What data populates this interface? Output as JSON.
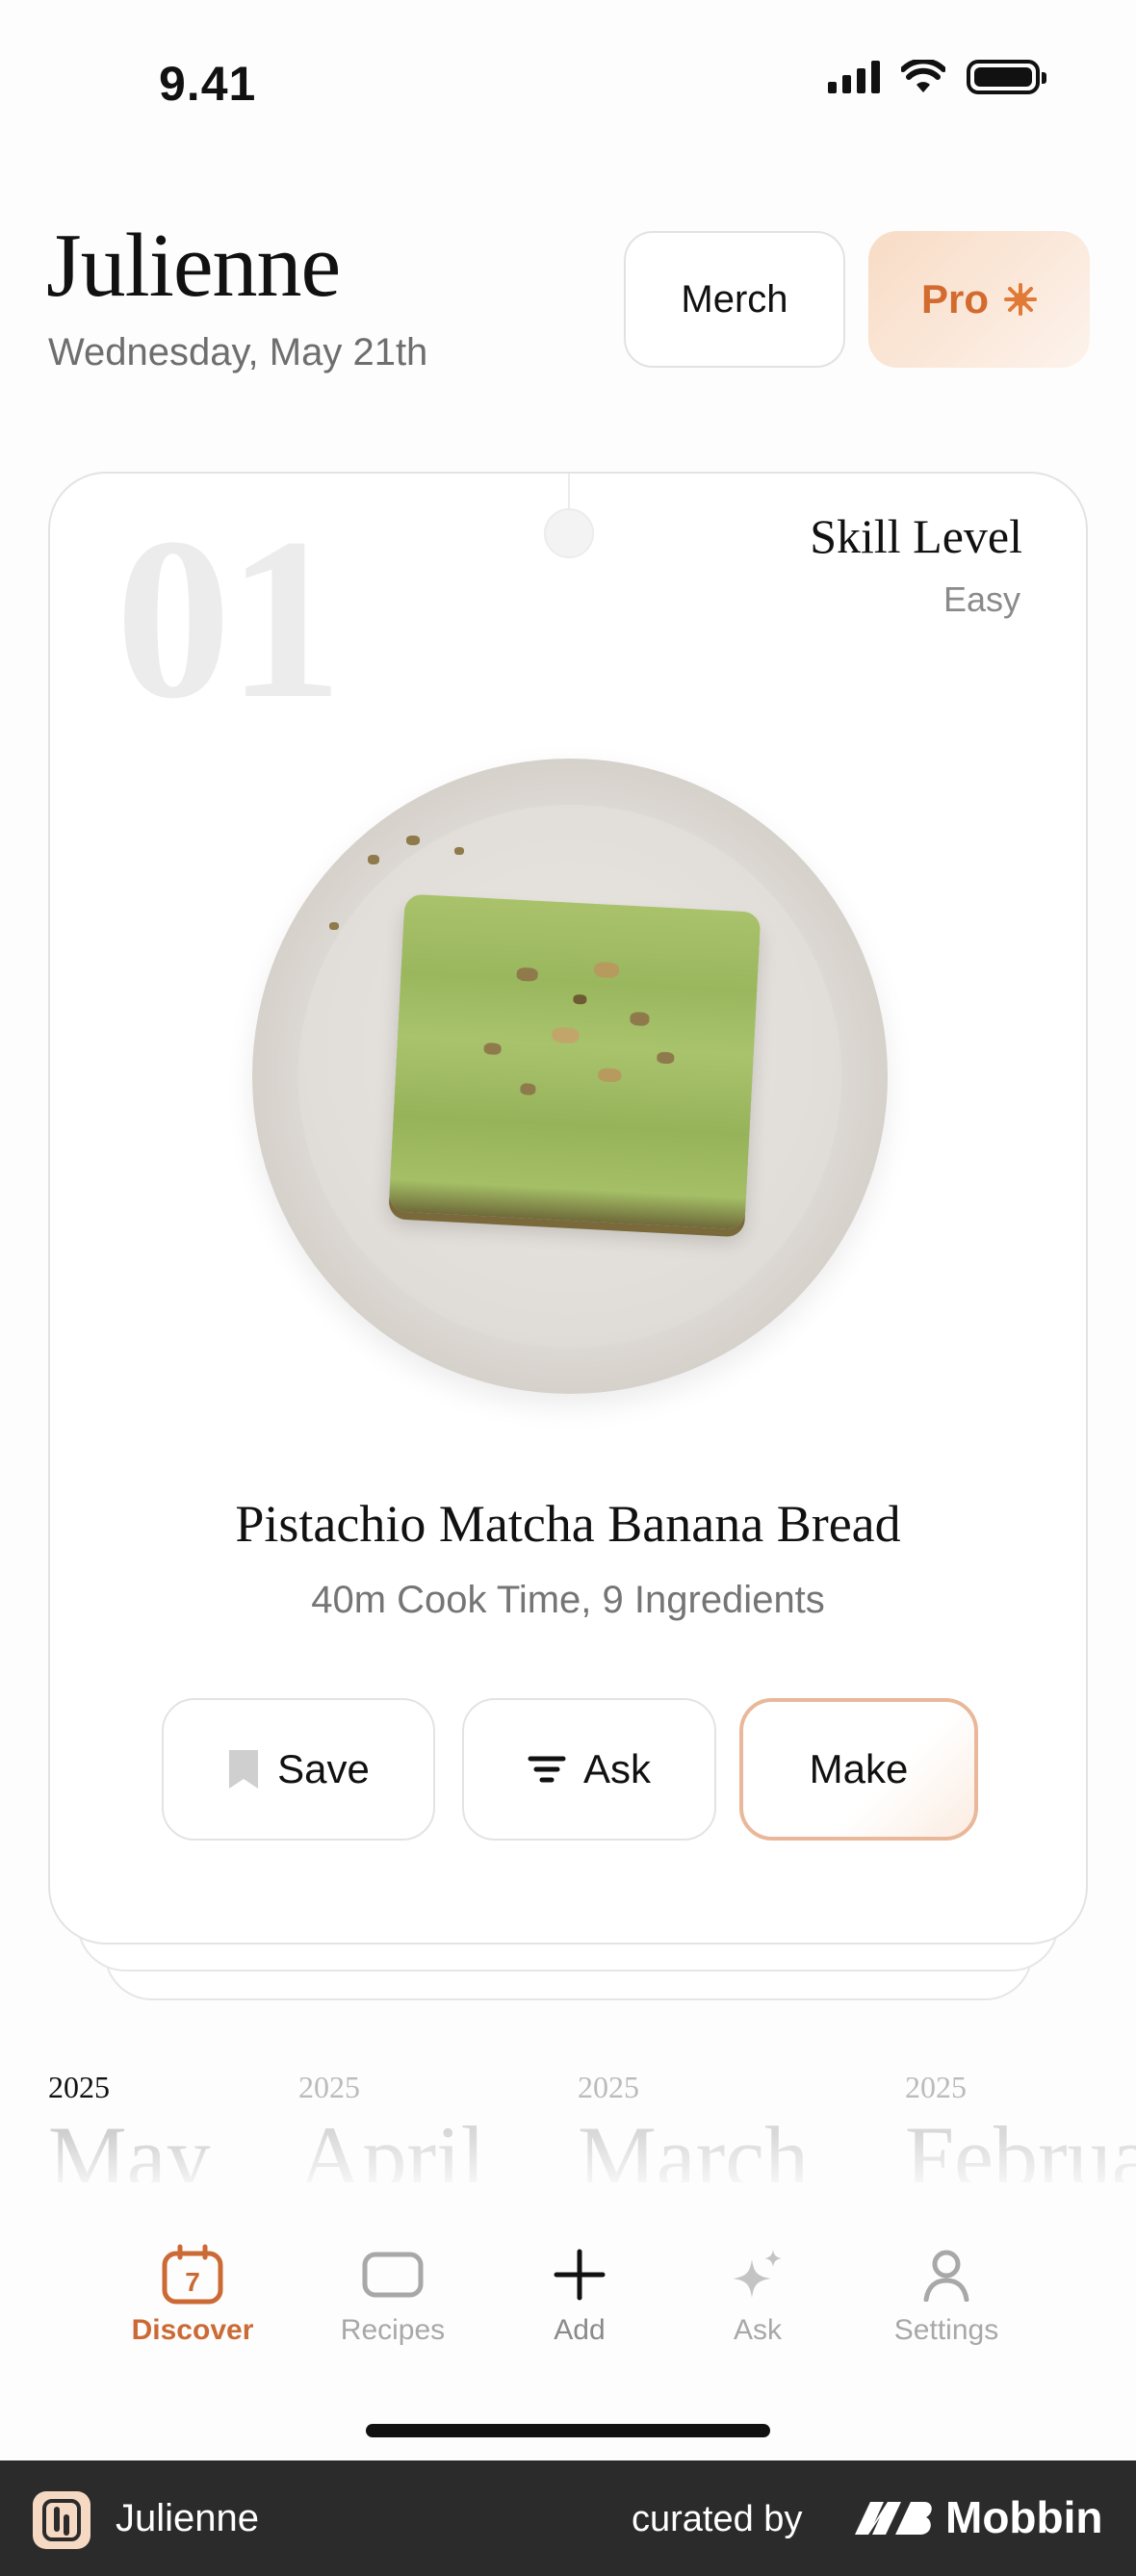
{
  "status_bar": {
    "time": "9.41"
  },
  "header": {
    "app_title": "Julienne",
    "date": "Wednesday, May 21th",
    "merch_label": "Merch",
    "pro_label": "Pro"
  },
  "card": {
    "number": "01",
    "skill_label": "Skill Level",
    "skill_value": "Easy",
    "recipe_title": "Pistachio Matcha Banana Bread",
    "recipe_meta": "40m Cook Time, 9 Ingredients",
    "save_label": "Save",
    "ask_label": "Ask",
    "make_label": "Make"
  },
  "months": [
    {
      "year": "2025",
      "month": "May"
    },
    {
      "year": "2025",
      "month": "April"
    },
    {
      "year": "2025",
      "month": "March"
    },
    {
      "year": "2025",
      "month": "February"
    }
  ],
  "tabs": [
    {
      "label": "Discover",
      "icon": "calendar-icon",
      "badge": "7"
    },
    {
      "label": "Recipes",
      "icon": "card-icon"
    },
    {
      "label": "Add",
      "icon": "plus-icon"
    },
    {
      "label": "Ask",
      "icon": "sparkle-icon"
    },
    {
      "label": "Settings",
      "icon": "person-icon"
    }
  ],
  "footer": {
    "app_name": "Julienne",
    "curated_by": "curated by",
    "brand": "Mobbin"
  },
  "colors": {
    "accent": "#cc6a35",
    "pro_bg": "#f8dcc5",
    "footer_bg": "#2b2b2b"
  }
}
